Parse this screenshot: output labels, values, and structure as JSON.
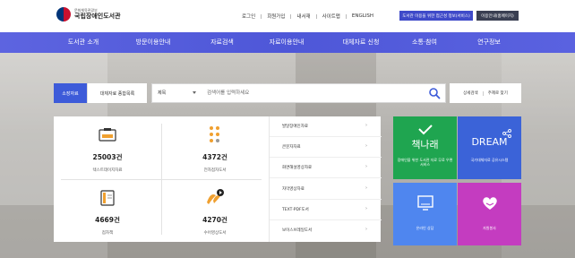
{
  "header": {
    "logo_sub": "문화체육관광부",
    "logo_title": "국립장애인도서관",
    "util_links": [
      "로그인",
      "회원가입",
      "내서재",
      "사이트맵",
      "ENGLISH"
    ],
    "util_btn_1": "도서관 이용을 위한 접근성 정보(서비스)",
    "util_btn_2": "이용안내(홈페이지)"
  },
  "nav": {
    "items": [
      "도서관 소개",
      "방문이용안내",
      "자료검색",
      "자료이용안내",
      "대체자료 신청",
      "소통·참여",
      "연구정보"
    ]
  },
  "search": {
    "tab_active": "소장자료",
    "tab_other": "대체자료 종합목록",
    "select_label": "제목",
    "placeholder": "검색어를 입력하세요",
    "side_links": [
      "상세검색",
      "주제로 찾기"
    ]
  },
  "stats": [
    {
      "count": "25003건",
      "label": "텍스트데이지자료",
      "icon": "daisy-icon"
    },
    {
      "count": "4372건",
      "label": "전자점자도서",
      "icon": "braille-icon"
    },
    {
      "count": "4669건",
      "label": "점자책",
      "icon": "book-icon"
    },
    {
      "count": "4270건",
      "label": "수어영상도서",
      "icon": "sign-video-icon"
    }
  ],
  "list": {
    "items": [
      "발달장애인자료",
      "큰문자자료",
      "화면해설영상자료",
      "자막영상자료",
      "TEXT·PDF도서",
      "보이스브레일도서"
    ],
    "arrow": "›"
  },
  "tiles": [
    {
      "title": "책나래",
      "sub": "장애인을 위한 도서관 자료 무료 우편서비스",
      "color": "#1fa550"
    },
    {
      "title": "DREAM",
      "sub": "국가대체자료 공유시스템",
      "color": "#3b63d8"
    },
    {
      "title": "",
      "sub": "온라인 상담",
      "color": "#4f86ef"
    },
    {
      "title": "",
      "sub": "자원봉사",
      "color": "#c43cc0"
    }
  ]
}
